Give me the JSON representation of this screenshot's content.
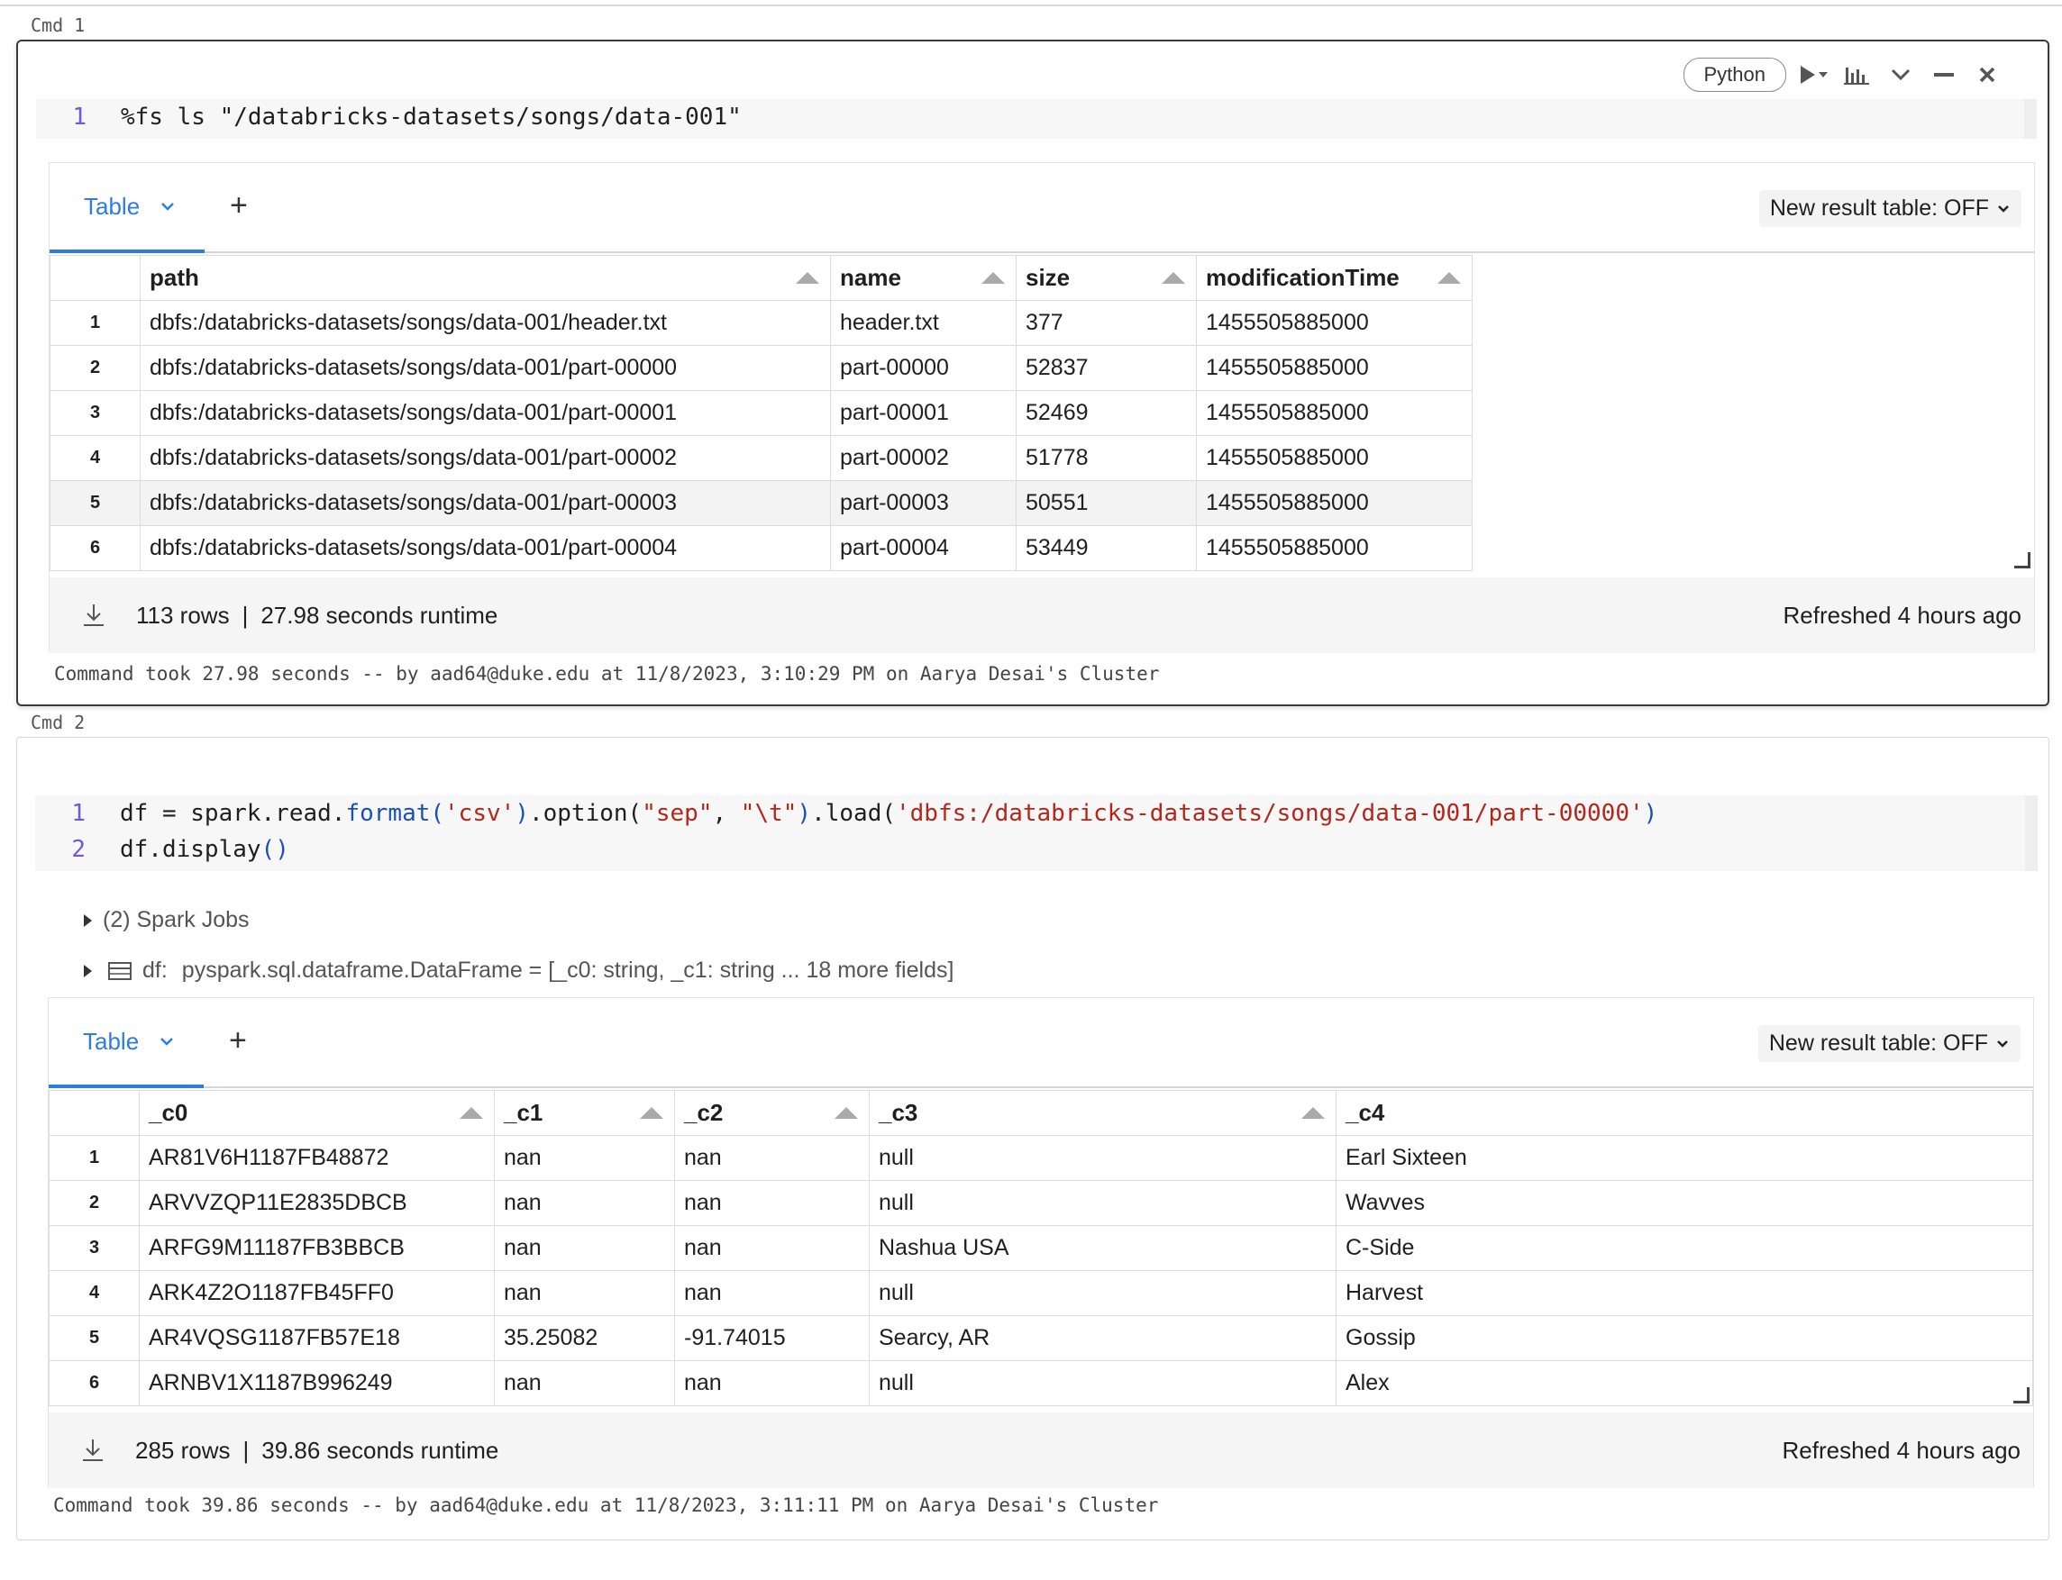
{
  "cmd1": {
    "label": "Cmd 1",
    "language": "Python",
    "code_lines": [
      {
        "num": "1",
        "tokens": [
          {
            "t": "%fs ls \"/databricks-datasets/songs/data-001\"",
            "k": "plain"
          }
        ]
      }
    ],
    "result": {
      "tab_label": "Table",
      "new_result_table": "New result table: OFF",
      "columns": [
        "path",
        "name",
        "size",
        "modificationTime"
      ],
      "rows": [
        [
          "1",
          "dbfs:/databricks-datasets/songs/data-001/header.txt",
          "header.txt",
          "377",
          "1455505885000"
        ],
        [
          "2",
          "dbfs:/databricks-datasets/songs/data-001/part-00000",
          "part-00000",
          "52837",
          "1455505885000"
        ],
        [
          "3",
          "dbfs:/databricks-datasets/songs/data-001/part-00001",
          "part-00001",
          "52469",
          "1455505885000"
        ],
        [
          "4",
          "dbfs:/databricks-datasets/songs/data-001/part-00002",
          "part-00002",
          "51778",
          "1455505885000"
        ],
        [
          "5",
          "dbfs:/databricks-datasets/songs/data-001/part-00003",
          "part-00003",
          "50551",
          "1455505885000"
        ],
        [
          "6",
          "dbfs:/databricks-datasets/songs/data-001/part-00004",
          "part-00004",
          "53449",
          "1455505885000"
        ]
      ],
      "row_count": "113 rows",
      "sep": "|",
      "runtime": "27.98 seconds runtime",
      "refreshed": "Refreshed 4 hours ago"
    },
    "meta": "Command took 27.98 seconds -- by aad64@duke.edu at 11/8/2023, 3:10:29 PM on Aarya Desai's Cluster"
  },
  "cmd2": {
    "label": "Cmd 2",
    "code_lines": [
      {
        "num": "1",
        "tokens": [
          {
            "t": "df = spark.read.",
            "k": "plain"
          },
          {
            "t": "format",
            "k": "fn"
          },
          {
            "t": "(",
            "k": "fn"
          },
          {
            "t": "'csv'",
            "k": "str"
          },
          {
            "t": ")",
            "k": "fn"
          },
          {
            "t": ".option(",
            "k": "plain"
          },
          {
            "t": "\"sep\"",
            "k": "str"
          },
          {
            "t": ", ",
            "k": "plain"
          },
          {
            "t": "\"\\t\"",
            "k": "str"
          },
          {
            "t": ")",
            "k": "fn"
          },
          {
            "t": ".load(",
            "k": "plain"
          },
          {
            "t": "'dbfs:/databricks-datasets/songs/data-001/part-00000'",
            "k": "str"
          },
          {
            "t": ")",
            "k": "fn"
          }
        ]
      },
      {
        "num": "2",
        "tokens": [
          {
            "t": "df.display",
            "k": "plain"
          },
          {
            "t": "()",
            "k": "fn"
          }
        ]
      }
    ],
    "spark_jobs": "(2) Spark Jobs",
    "df_name": "df:",
    "df_schema": "pyspark.sql.dataframe.DataFrame = [_c0: string, _c1: string ... 18 more fields]",
    "result": {
      "tab_label": "Table",
      "new_result_table": "New result table: OFF",
      "columns": [
        "_c0",
        "_c1",
        "_c2",
        "_c3",
        "_c4"
      ],
      "rows": [
        [
          "1",
          "AR81V6H1187FB48872",
          "nan",
          "nan",
          "null",
          "Earl Sixteen"
        ],
        [
          "2",
          "ARVVZQP11E2835DBCB",
          "nan",
          "nan",
          "null",
          "Wavves"
        ],
        [
          "3",
          "ARFG9M11187FB3BBCB",
          "nan",
          "nan",
          "Nashua USA",
          "C-Side"
        ],
        [
          "4",
          "ARK4Z2O1187FB45FF0",
          "nan",
          "nan",
          "null",
          "Harvest"
        ],
        [
          "5",
          "AR4VQSG1187FB57E18",
          "35.25082",
          "-91.74015",
          "Searcy, AR",
          "Gossip"
        ],
        [
          "6",
          "ARNBV1X1187B996249",
          "nan",
          "nan",
          "null",
          "Alex"
        ]
      ],
      "row_count": "285 rows",
      "sep": "|",
      "runtime": "39.86 seconds runtime",
      "refreshed": "Refreshed 4 hours ago"
    },
    "meta": "Command took 39.86 seconds -- by aad64@duke.edu at 11/8/2023, 3:11:11 PM on Aarya Desai's Cluster"
  },
  "colors": {
    "accent": "#2d7de0",
    "line_number": "#6c5bd6",
    "string": "#b5261a",
    "function": "#1a4fc4"
  }
}
